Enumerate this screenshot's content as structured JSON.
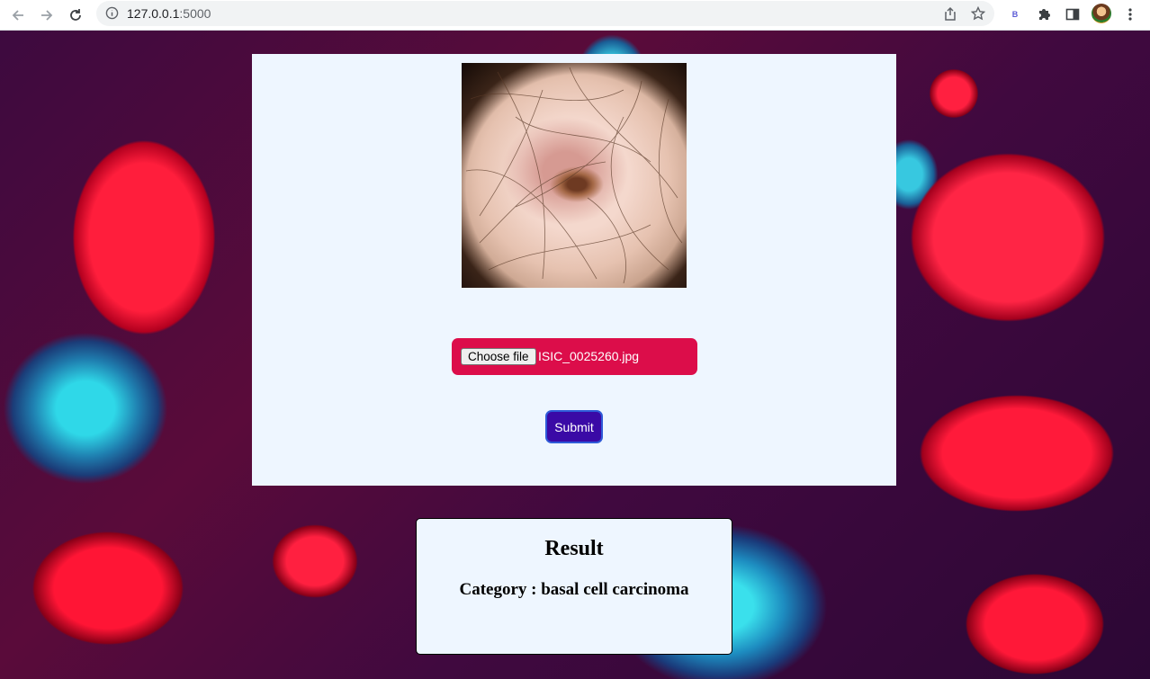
{
  "browser": {
    "url_host": "127.0.0.1",
    "url_port": ":5000",
    "extension_label": "B",
    "icons": [
      "back-arrow-icon",
      "forward-arrow-icon",
      "reload-icon",
      "info-icon",
      "share-icon",
      "bookmark-star-icon",
      "extension-b-icon",
      "puzzle-icon",
      "side-panel-icon",
      "avatar",
      "kebab-menu-icon"
    ]
  },
  "upload": {
    "choose_label": "Choose file",
    "file_name": "ISIC_0025260.jpg",
    "submit_label": "Submit"
  },
  "result": {
    "title": "Result",
    "category": "Category : basal cell carcinoma"
  },
  "colors": {
    "panel_bg": "#eef6ff",
    "file_row_bg": "#dc0d4a",
    "submit_bg": "#3a0aa6",
    "submit_border": "#2f5bd8"
  }
}
